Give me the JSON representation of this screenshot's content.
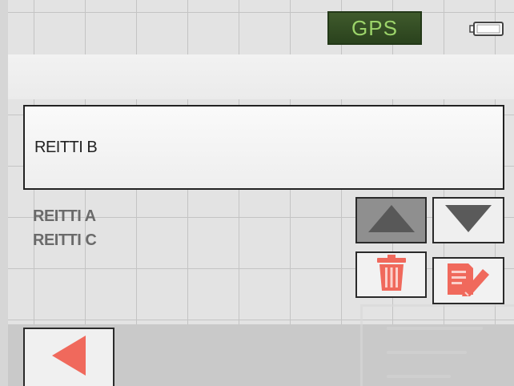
{
  "status_bar": {
    "gps_label": "GPS",
    "battery_icon": "battery-icon"
  },
  "route_selected": "REITTI B",
  "routes": [
    "REITTI A",
    "REITTI C"
  ],
  "controls": {
    "move_up_icon": "triangle-up-icon",
    "move_down_icon": "triangle-down-icon",
    "delete_icon": "trash-icon",
    "edit_icon": "edit-document-icon",
    "back_icon": "back-arrow-icon"
  },
  "colors": {
    "gps_background": "#34502a",
    "gps_text": "#9cd46a",
    "icon_red": "#f0695c",
    "arrow_gray": "#585858"
  }
}
